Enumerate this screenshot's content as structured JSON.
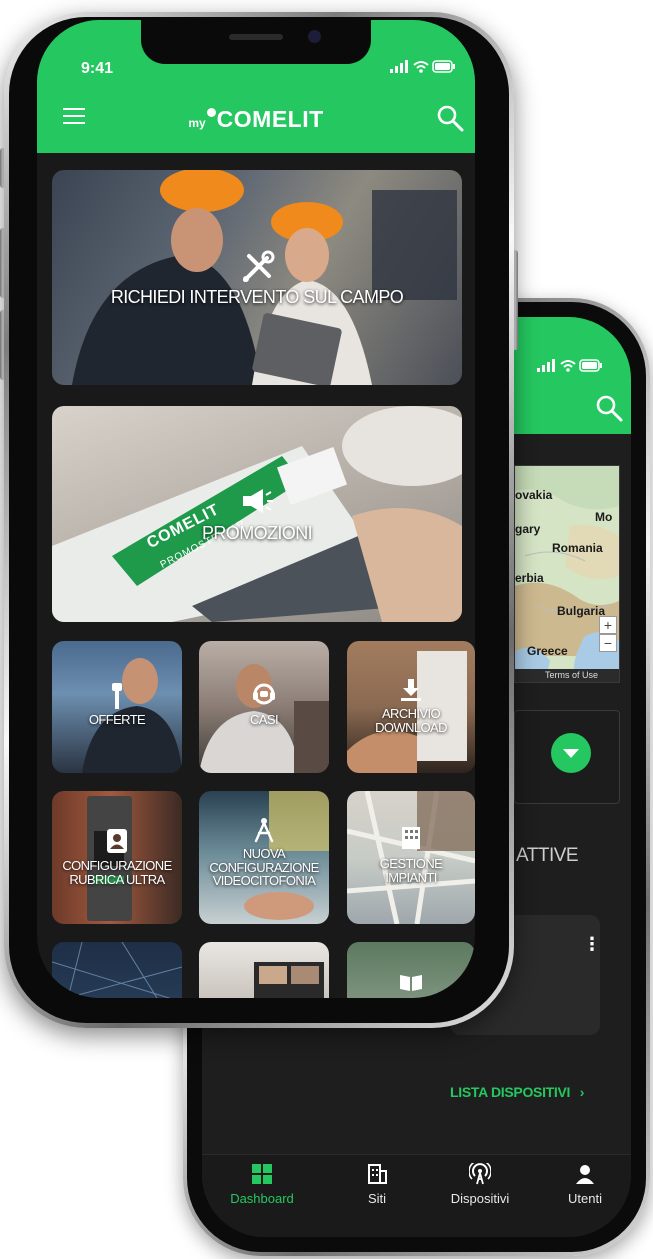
{
  "front": {
    "status": {
      "time": "9:41"
    },
    "header": {
      "logo_prefix": "my",
      "logo_brand": "OMELIT",
      "logo_brand_initial": "C"
    },
    "tiles": [
      {
        "label": "RICHIEDI INTERVENTO SUL CAMPO",
        "icon": "tools-icon"
      },
      {
        "label": "PROMOZIONI",
        "icon": "megaphone-icon"
      },
      {
        "label": "OFFERTE",
        "icon": "tag-icon"
      },
      {
        "label": "CASI",
        "icon": "support-icon"
      },
      {
        "label_lines": [
          "ARCHIVIO",
          "DOWNLOAD"
        ],
        "icon": "download-icon"
      },
      {
        "label_lines": [
          "CONFIGURAZIONE",
          "RUBRICA ULTRA"
        ],
        "icon": "contact-book-icon"
      },
      {
        "label_lines": [
          "NUOVA",
          "CONFIGURAZIONE",
          "VIDEOCITOFONIA"
        ],
        "icon": "compass-icon"
      },
      {
        "label_lines": [
          "GESTIONE",
          "IMPIANTI"
        ],
        "icon": "building-icon"
      }
    ],
    "image_texts": {
      "promo_brochure_brand": "COMELIT",
      "promo_brochure_sub": "PROMOSTELLAR"
    }
  },
  "back": {
    "map": {
      "labels": [
        "ovakia",
        "Mo",
        "gary",
        "Romania",
        "erbia",
        "Bulgaria",
        "Greece"
      ],
      "zoom_in": "+",
      "zoom_out": "−",
      "terms": "Terms of Use"
    },
    "section_title": "ATTIVE",
    "device_link": "LISTA DISPOSITIVI",
    "device_link_chevron": "›",
    "tabs": [
      {
        "label": "Dashboard",
        "icon": "dashboard-icon",
        "active": true
      },
      {
        "label": "Siti",
        "icon": "building-icon",
        "active": false
      },
      {
        "label": "Dispositivi",
        "icon": "antenna-icon",
        "active": false
      },
      {
        "label": "Utenti",
        "icon": "user-icon",
        "active": false
      }
    ]
  },
  "colors": {
    "brand_green": "#25c760",
    "screen_bg": "#191919"
  }
}
